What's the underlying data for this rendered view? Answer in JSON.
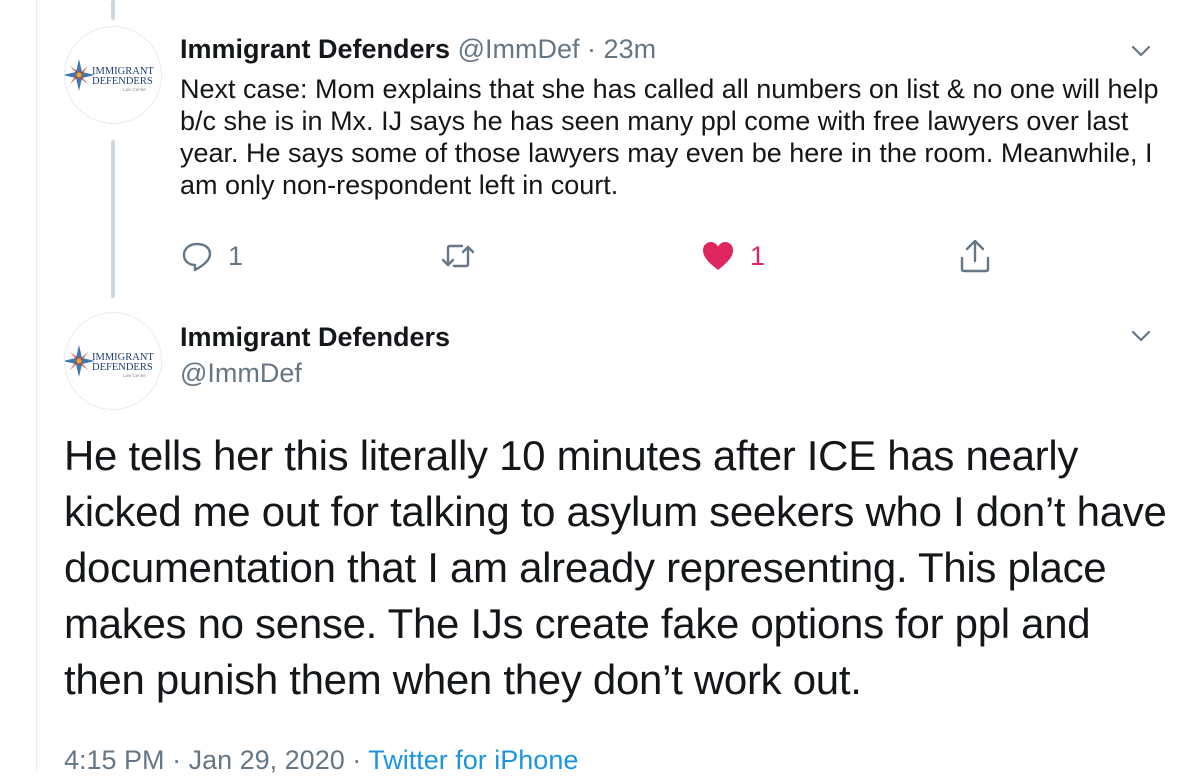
{
  "colors": {
    "text": "#14171a",
    "muted": "#657786",
    "like_red": "#e0245e",
    "link_blue": "#1b95e0",
    "thread_line": "#ccd6dd"
  },
  "tweet1": {
    "avatar_icon": "immigrant-defenders-logo",
    "avatar_text": [
      "IMMIGRANT",
      "DEFENDERS",
      "Law Center"
    ],
    "name": "Immigrant Defenders",
    "handle": "@ImmDef",
    "separator": "·",
    "time": "23m",
    "text": "Next case: Mom explains that she has called all numbers on list & no one will help b/c she is in Mx. IJ says he has seen many ppl come with free lawyers over last year. He says some of those lawyers may even be here in the room. Meanwhile, I am only non-respondent left in court.",
    "actions": {
      "reply_icon": "reply-icon",
      "reply_count": "1",
      "retweet_icon": "retweet-icon",
      "like_icon": "heart-icon",
      "like_count": "1",
      "share_icon": "share-icon"
    }
  },
  "tweet2": {
    "avatar_icon": "immigrant-defenders-logo",
    "avatar_text": [
      "IMMIGRANT",
      "DEFENDERS",
      "Law Center"
    ],
    "name": "Immigrant Defenders",
    "handle": "@ImmDef",
    "text": "He tells her this literally 10 minutes after ICE has nearly kicked me out for talking to asylum seekers who I don’t have documentation that I am already representing. This place makes no sense. The IJs create fake options for ppl and then punish them when they don’t work out.",
    "time": "4:15 PM",
    "separator": "·",
    "date": "Jan 29, 2020",
    "source": "Twitter for iPhone"
  }
}
